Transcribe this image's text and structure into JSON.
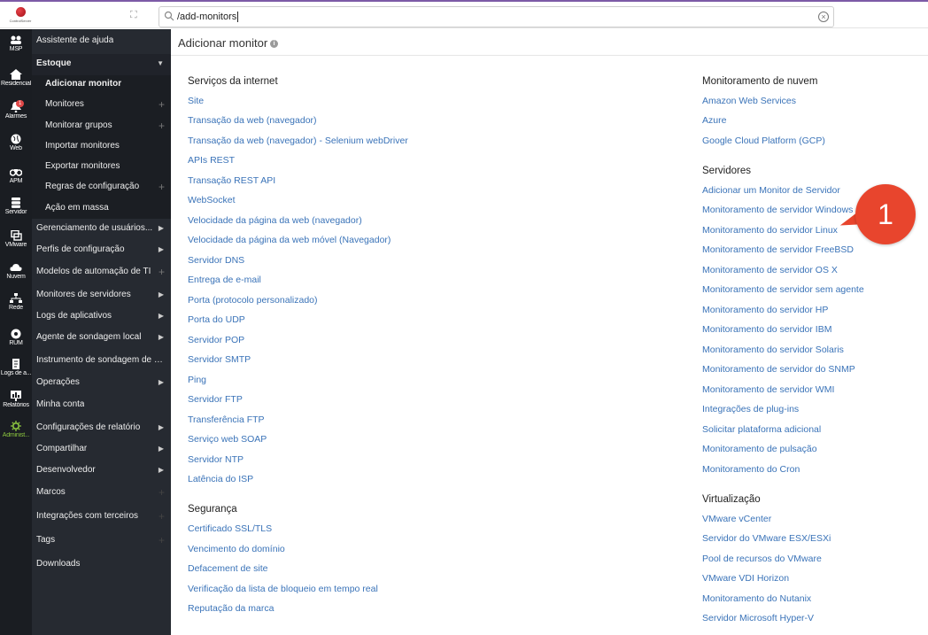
{
  "logo": {
    "text": "ControlServer"
  },
  "search": {
    "value": "/add-monitors"
  },
  "rail": [
    {
      "label": "MSP",
      "icon": "msp-icon"
    },
    {
      "label": "Residencial",
      "icon": "home-icon"
    },
    {
      "label": "Alarmes",
      "icon": "bell-icon",
      "badge": "1"
    },
    {
      "label": "Web",
      "icon": "globe-icon"
    },
    {
      "label": "APM",
      "icon": "binoculars-icon"
    },
    {
      "label": "Servidor",
      "icon": "server-icon"
    },
    {
      "label": "VMware",
      "icon": "vmware-icon"
    },
    {
      "label": "Nuvem",
      "icon": "cloud-icon"
    },
    {
      "label": "Rede",
      "icon": "network-icon"
    },
    {
      "label": "RUM",
      "icon": "rum-icon"
    },
    {
      "label": "Logs de a...",
      "icon": "log-icon"
    },
    {
      "label": "Relatórios",
      "icon": "report-icon"
    },
    {
      "label": "Administ...",
      "icon": "gear-icon"
    }
  ],
  "menu": {
    "help": "Assistente de ajuda",
    "estoque": "Estoque",
    "sub": [
      "Adicionar monitor",
      "Monitores",
      "Monitorar grupos",
      "Importar monitores",
      "Exportar monitores",
      "Regras de configuração",
      "Ação em massa"
    ],
    "items": [
      "Gerenciamento de usuários...",
      "Perfis de configuração",
      "Modelos de automação de TI",
      "Monitores de servidores",
      "Logs de aplicativos",
      "Agente de sondagem local",
      "Instrumento de sondagem de re...",
      "Operações",
      "Minha conta",
      "Configurações de relatório",
      "Compartilhar",
      "Desenvolvedor",
      "Marcos",
      "Integrações com terceiros",
      "Tags",
      "Downloads"
    ]
  },
  "page": {
    "title": "Adicionar monitor"
  },
  "columns": {
    "left": {
      "internet_heading": "Serviços da internet",
      "internet": [
        "Site",
        "Transação da web (navegador)",
        "Transação da web (navegador) - Selenium webDriver",
        "APIs REST",
        "Transação REST API",
        "WebSocket",
        "Velocidade da página da web (navegador)",
        "Velocidade da página da web móvel (Navegador)",
        "Servidor DNS",
        "Entrega de e-mail",
        "Porta (protocolo personalizado)",
        "Porta do UDP",
        "Servidor POP",
        "Servidor SMTP",
        "Ping",
        "Servidor FTP",
        "Transferência FTP",
        "Serviço web SOAP",
        "Servidor NTP",
        "Latência do ISP"
      ],
      "security_heading": "Segurança",
      "security": [
        "Certificado SSL/TLS",
        "Vencimento do domínio",
        "Defacement de site",
        "Verificação da lista de bloqueio em tempo real",
        "Reputação da marca"
      ]
    },
    "right": {
      "cloud_heading": "Monitoramento de nuvem",
      "cloud": [
        "Amazon Web Services",
        "Azure",
        "Google Cloud Platform (GCP)"
      ],
      "servers_heading": "Servidores",
      "servers": [
        "Adicionar um Monitor de Servidor",
        "Monitoramento de servidor Windows",
        "Monitoramento do servidor Linux",
        "Monitoramento de servidor FreeBSD",
        "Monitoramento de servidor OS X",
        "Monitoramento de servidor sem agente",
        "Monitoramento do servidor HP",
        "Monitoramento do servidor IBM",
        "Monitoramento do servidor Solaris",
        "Monitoramento de servidor do SNMP",
        "Monitoramento de servidor WMI",
        "Integrações de plug-ins",
        "Solicitar plataforma adicional",
        "Monitoramento de pulsação",
        "Monitoramento do Cron"
      ],
      "virt_heading": "Virtualização",
      "virt": [
        "VMware vCenter",
        "Servidor do VMware ESX/ESXi",
        "Pool de recursos do VMware",
        "VMware VDI Horizon",
        "Monitoramento do Nutanix",
        "Servidor Microsoft Hyper-V"
      ]
    }
  },
  "callout": {
    "number": "1"
  },
  "colors": {
    "link": "#3a73b8",
    "callout": "#e8452d",
    "sidebar": "#262a31",
    "rail": "#1a1d22",
    "active_admin": "#8cc63f"
  }
}
